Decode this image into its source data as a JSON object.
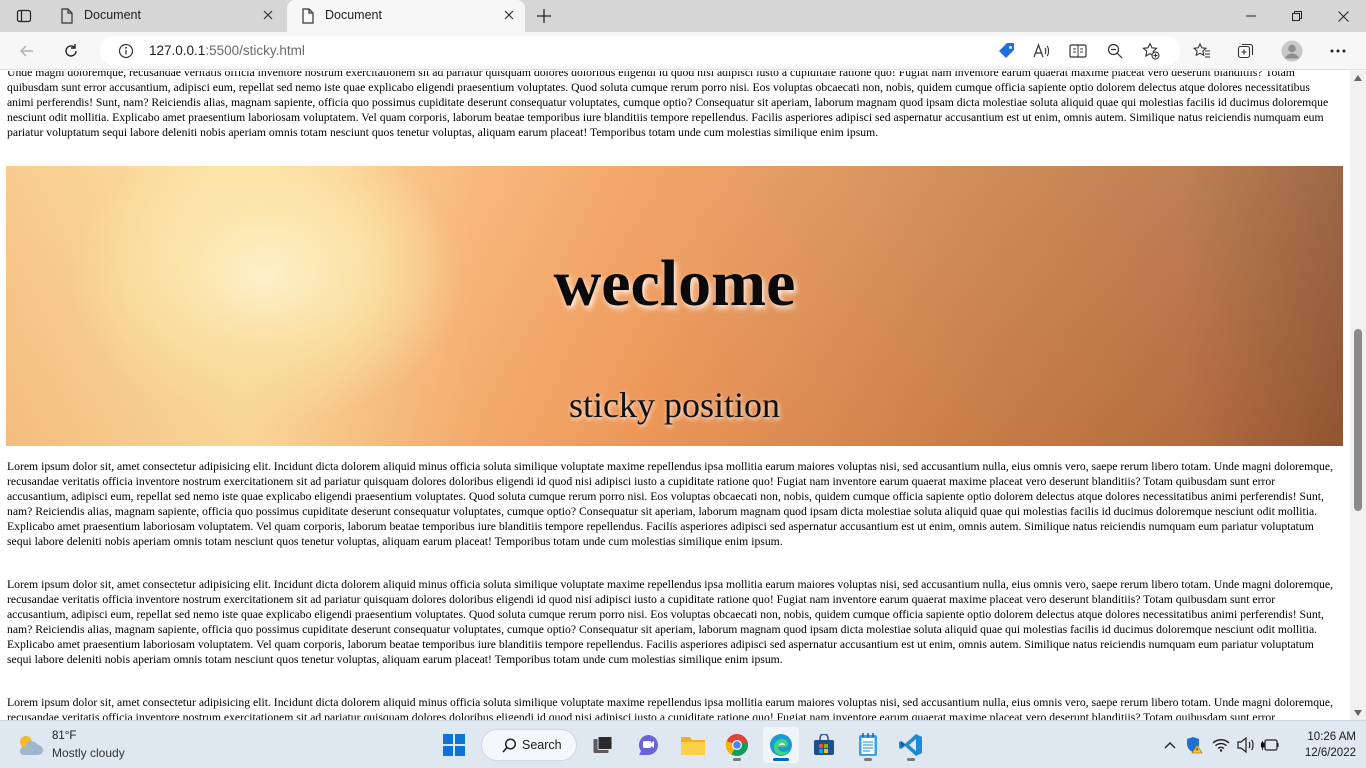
{
  "browser": {
    "tabs": [
      {
        "title": "Document",
        "active": false
      },
      {
        "title": "Document",
        "active": true
      }
    ],
    "address": {
      "host": "127.0.0.1",
      "rest": ":5500/sticky.html"
    }
  },
  "page": {
    "top_paragraph": "Unde magni doloremque, recusandae veritatis officia inventore nostrum exercitationem sit ad pariatur quisquam dolores doloribus eligendi id quod nisi adipisci iusto a cupiditate ratione quo! Fugiat nam inventore earum quaerat maxime placeat vero deserunt blanditiis? Totam quibusdam sunt error accusantium, adipisci eum, repellat sed nemo iste quae explicabo eligendi praesentium voluptates. Quod soluta cumque rerum porro nisi. Eos voluptas obcaecati non, nobis, quidem cumque officia sapiente optio dolorem delectus atque dolores necessitatibus animi perferendis! Sunt, nam? Reiciendis alias, magnam sapiente, officia quo possimus cupiditate deserunt consequatur voluptates, cumque optio? Consequatur sit aperiam, laborum magnam quod ipsam dicta molestiae soluta aliquid quae qui molestias facilis id ducimus doloremque nesciunt odit mollitia. Explicabo amet praesentium laboriosam voluptatem. Vel quam corporis, laborum beatae temporibus iure blanditiis tempore repellendus. Facilis asperiores adipisci sed aspernatur accusantium est ut enim, omnis autem. Similique natus reiciendis numquam eum pariatur voluptatum sequi labore deleniti nobis aperiam omnis totam nesciunt quos tenetur voluptas, aliquam earum placeat! Temporibus totam unde cum molestias similique enim ipsum.",
    "hero_title": "weclome",
    "hero_subtitle": "sticky position",
    "paragraph": "Lorem ipsum dolor sit, amet consectetur adipisicing elit. Incidunt dicta dolorem aliquid minus officia soluta similique voluptate maxime repellendus ipsa mollitia earum maiores voluptas nisi, sed accusantium nulla, eius omnis vero, saepe rerum libero totam. Unde magni doloremque, recusandae veritatis officia inventore nostrum exercitationem sit ad pariatur quisquam dolores doloribus eligendi id quod nisi adipisci iusto a cupiditate ratione quo! Fugiat nam inventore earum quaerat maxime placeat vero deserunt blanditiis? Totam quibusdam sunt error accusantium, adipisci eum, repellat sed nemo iste quae explicabo eligendi praesentium voluptates. Quod soluta cumque rerum porro nisi. Eos voluptas obcaecati non, nobis, quidem cumque officia sapiente optio dolorem delectus atque dolores necessitatibus animi perferendis! Sunt, nam? Reiciendis alias, magnam sapiente, officia quo possimus cupiditate deserunt consequatur voluptates, cumque optio? Consequatur sit aperiam, laborum magnam quod ipsam dicta molestiae soluta aliquid quae qui molestias facilis id ducimus doloremque nesciunt odit mollitia. Explicabo amet praesentium laboriosam voluptatem. Vel quam corporis, laborum beatae temporibus iure blanditiis tempore repellendus. Facilis asperiores adipisci sed aspernatur accusantium est ut enim, omnis autem. Similique natus reiciendis numquam eum pariatur voluptatum sequi labore deleniti nobis aperiam omnis totam nesciunt quos tenetur voluptas, aliquam earum placeat! Temporibus totam unde cum molestias similique enim ipsum."
  },
  "taskbar": {
    "weather": {
      "temp": "81°F",
      "condition": "Mostly cloudy"
    },
    "search_label": "Search",
    "time": "10:26 AM",
    "date": "12/6/2022"
  }
}
